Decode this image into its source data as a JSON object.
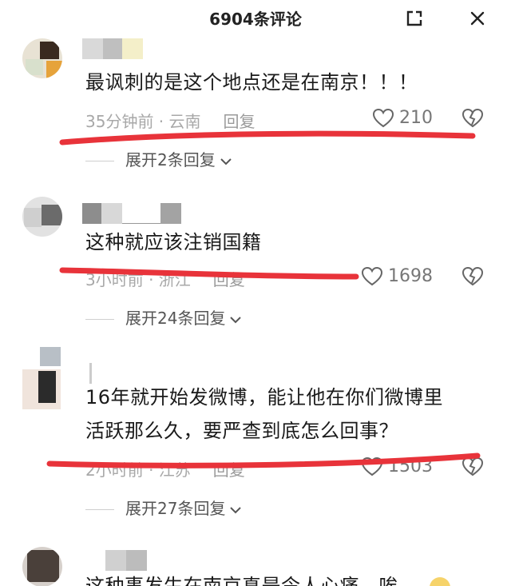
{
  "header": {
    "title": "6904条评论"
  },
  "comments": [
    {
      "text": "最讽刺的是这个地点还是在南京！！！",
      "time": "35分钟前 · 云南",
      "reply_label": "回复",
      "likes": "210",
      "expand_label": "展开2条回复"
    },
    {
      "text": "这种就应该注销国籍",
      "time": "3小时前 · 浙江",
      "reply_label": "回复",
      "likes": "1698",
      "expand_label": "展开24条回复"
    },
    {
      "text_line1": "16年就开始发微博，能让他在你们微博里",
      "text_line2": "活跃那么久，要严查到底怎么回事？",
      "time": "2小时前 · 江苏",
      "reply_label": "回复",
      "likes": "1503",
      "expand_label": "展开27条回复"
    },
    {
      "text": "这种事发生在南京真是令人心痛，唉"
    }
  ],
  "colors": {
    "annotation_red": "#e8333a",
    "meta_gray": "#a8a8a8"
  },
  "icons": [
    "expand-icon",
    "close-icon",
    "heart-icon",
    "broken-heart-icon",
    "chevron-down-icon"
  ]
}
